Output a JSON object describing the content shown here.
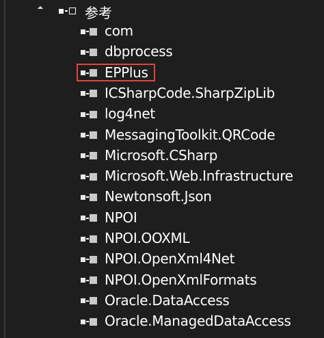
{
  "tree": {
    "folder": {
      "label": "参考",
      "expand_icon": "expanded-triangle-icon",
      "icon": "references-folder-icon"
    },
    "items": [
      {
        "label": "com",
        "icon": "reference-icon"
      },
      {
        "label": "dbprocess",
        "icon": "reference-icon"
      },
      {
        "label": "EPPlus",
        "icon": "reference-icon",
        "highlighted": true
      },
      {
        "label": "ICSharpCode.SharpZipLib",
        "icon": "reference-icon"
      },
      {
        "label": "log4net",
        "icon": "reference-icon"
      },
      {
        "label": "MessagingToolkit.QRCode",
        "icon": "reference-icon"
      },
      {
        "label": "Microsoft.CSharp",
        "icon": "reference-icon"
      },
      {
        "label": "Microsoft.Web.Infrastructure",
        "icon": "reference-icon"
      },
      {
        "label": "Newtonsoft.Json",
        "icon": "reference-icon"
      },
      {
        "label": "NPOI",
        "icon": "reference-icon"
      },
      {
        "label": "NPOI.OOXML",
        "icon": "reference-icon"
      },
      {
        "label": "NPOI.OpenXml4Net",
        "icon": "reference-icon"
      },
      {
        "label": "NPOI.OpenXmlFormats",
        "icon": "reference-icon"
      },
      {
        "label": "Oracle.DataAccess",
        "icon": "reference-icon"
      },
      {
        "label": "Oracle.ManagedDataAccess",
        "icon": "reference-icon"
      }
    ]
  },
  "colors": {
    "background": "#1e1e1e",
    "text": "#ffffff",
    "highlight": "#e0453b"
  }
}
